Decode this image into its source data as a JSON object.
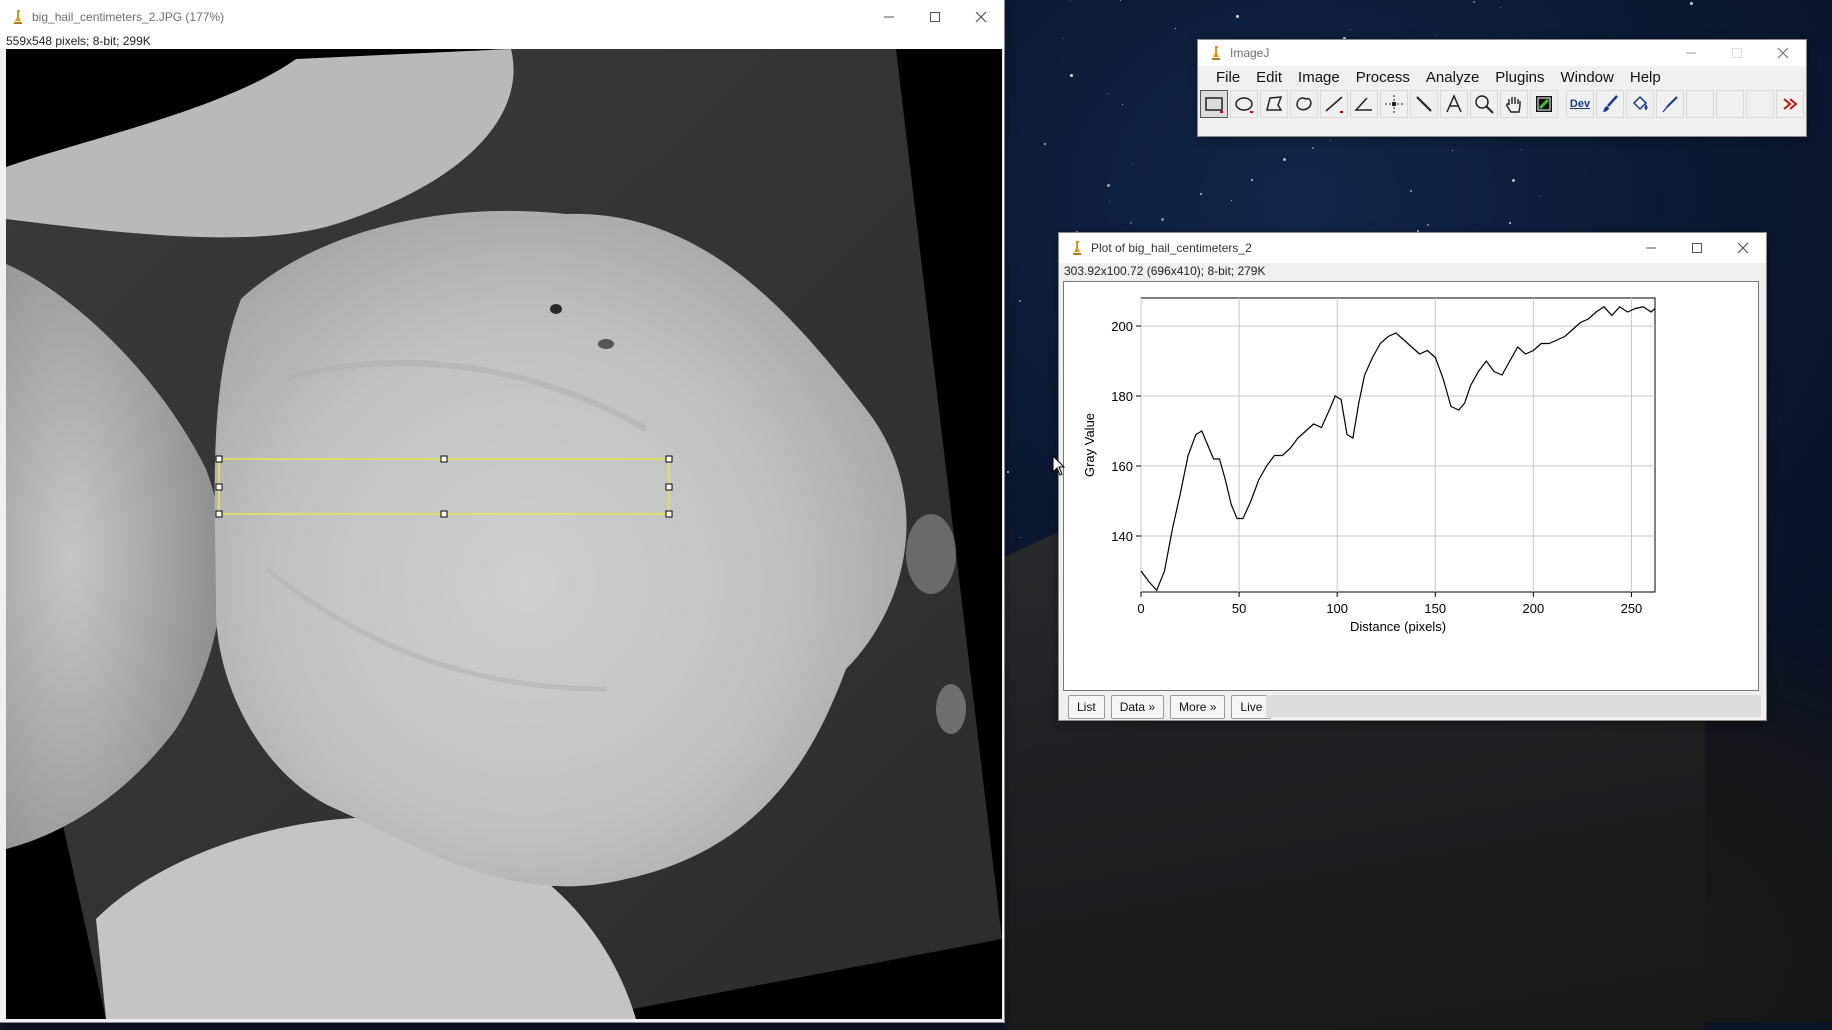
{
  "image_window": {
    "title": "big_hail_centimeters_2.JPG (177%)",
    "info": "559x548 pixels; 8-bit; 299K"
  },
  "imagej_window": {
    "title": "ImageJ",
    "menus": [
      "File",
      "Edit",
      "Image",
      "Process",
      "Analyze",
      "Plugins",
      "Window",
      "Help"
    ],
    "tools": [
      {
        "name": "rectangle-tool",
        "active": true
      },
      {
        "name": "oval-tool"
      },
      {
        "name": "polygon-tool"
      },
      {
        "name": "freehand-tool"
      },
      {
        "name": "line-tool"
      },
      {
        "name": "angle-tool"
      },
      {
        "name": "point-tool"
      },
      {
        "name": "wand-tool"
      },
      {
        "name": "text-tool"
      },
      {
        "name": "magnifier-tool"
      },
      {
        "name": "scroll-tool"
      },
      {
        "name": "color-picker-tool"
      },
      {
        "name": "dev-tool",
        "label": "Dev"
      },
      {
        "name": "paintbrush-tool"
      },
      {
        "name": "flood-fill-tool"
      },
      {
        "name": "pipette-tool"
      },
      {
        "name": "empty-slot-1"
      },
      {
        "name": "empty-slot-2"
      },
      {
        "name": "empty-slot-3"
      },
      {
        "name": "more-tools"
      }
    ]
  },
  "plot_window": {
    "title": "Plot of big_hail_centimeters_2",
    "info": "303.92x100.72   (696x410); 8-bit; 279K",
    "buttons": {
      "list": "List",
      "data": "Data »",
      "more": "More »",
      "live": "Live"
    }
  },
  "chart_data": {
    "type": "line",
    "xlabel": "Distance (pixels)",
    "ylabel": "Gray Value",
    "xlim": [
      0,
      262
    ],
    "ylim": [
      124,
      208
    ],
    "xticks": [
      0,
      50,
      100,
      150,
      200,
      250
    ],
    "yticks": [
      140,
      160,
      180,
      200
    ],
    "grid": true,
    "series": [
      {
        "x": [
          0,
          4,
          8,
          12,
          16,
          20,
          24,
          28,
          31,
          34,
          37,
          40,
          43,
          46,
          49,
          52,
          56,
          60,
          64,
          68,
          72,
          76,
          80,
          84,
          88,
          92,
          96,
          99,
          102,
          105,
          108,
          111,
          114,
          118,
          122,
          126,
          130,
          134,
          138,
          142,
          146,
          150,
          154,
          158,
          162,
          165,
          168,
          172,
          176,
          180,
          184,
          188,
          192,
          196,
          200,
          204,
          208,
          212,
          216,
          220,
          224,
          228,
          232,
          236,
          240,
          244,
          248,
          252,
          256,
          260,
          262
        ],
        "y": [
          130,
          127,
          124.5,
          130,
          142,
          152,
          163,
          169,
          170,
          166,
          162,
          162,
          156,
          149,
          145,
          145,
          150,
          156,
          160,
          163,
          163,
          165,
          168,
          170,
          172,
          171,
          176,
          180,
          179,
          169,
          168,
          178,
          186,
          191,
          195,
          197,
          198,
          196,
          194,
          192,
          193,
          191,
          185,
          177,
          176,
          178,
          183,
          187,
          190,
          187,
          186,
          190,
          194,
          192,
          193,
          195,
          195,
          196,
          197,
          199,
          201,
          202,
          204,
          205.5,
          203,
          205.5,
          204,
          205,
          205.5,
          204,
          205
        ]
      }
    ]
  }
}
